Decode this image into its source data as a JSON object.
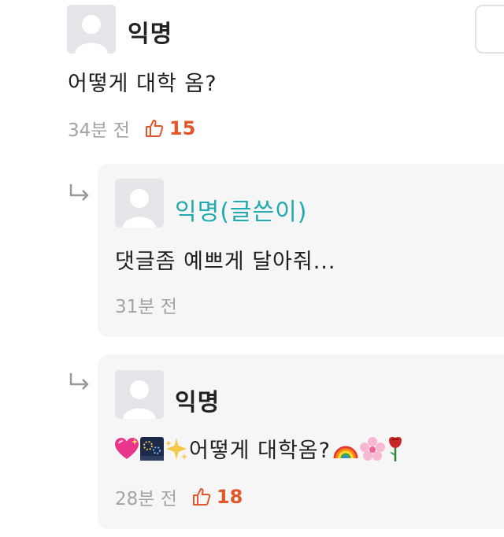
{
  "post": {
    "author": "익명",
    "text": "어떻게 대학 옴?",
    "time": "34분 전",
    "likes": "15"
  },
  "replies": [
    {
      "author": "익명(글쓴이)",
      "text": "댓글좀 예쁘게 달아줘...",
      "time": "31분 전"
    },
    {
      "author": "익명",
      "text": "어떻게 대학옴?",
      "time": "28분 전",
      "likes": "18"
    }
  ],
  "colors": {
    "author_accent": "#1fa9b0",
    "like_color": "#e0582a",
    "meta_gray": "#a3a3a3",
    "card_bg": "#f6f6f7"
  },
  "icons": [
    "avatar-placeholder",
    "thumbs-up-icon",
    "reply-arrow-icon",
    "more-button"
  ]
}
